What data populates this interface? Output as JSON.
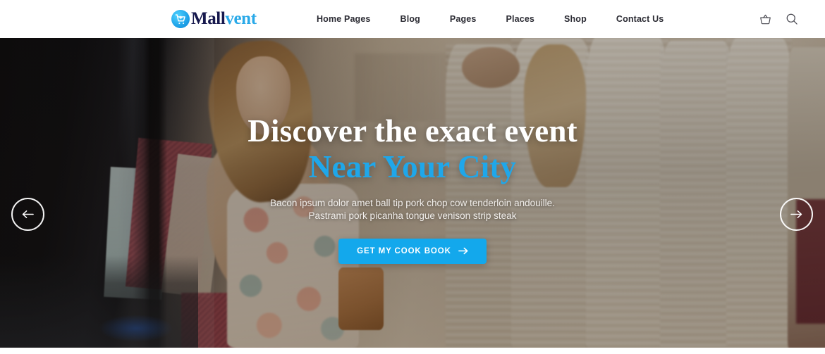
{
  "header": {
    "logo": {
      "icon": "shopping-cart-circle-icon",
      "text_primary": "Mall",
      "text_accent": "vent"
    },
    "nav": [
      {
        "label": "Home Pages",
        "name": "nav-item-home-pages"
      },
      {
        "label": "Blog",
        "name": "nav-item-blog"
      },
      {
        "label": "Pages",
        "name": "nav-item-pages"
      },
      {
        "label": "Places",
        "name": "nav-item-places"
      },
      {
        "label": "Shop",
        "name": "nav-item-shop"
      },
      {
        "label": "Contact Us",
        "name": "nav-item-contact-us"
      }
    ],
    "icons": [
      {
        "name": "shopping-basket-icon"
      },
      {
        "name": "search-icon"
      }
    ]
  },
  "hero": {
    "title_line1": "Discover the exact event",
    "title_line2": "Near Your City",
    "subtitle": "Bacon ipsum dolor amet ball tip pork chop cow tenderloin andouille. Pastrami pork picanha tongue venison strip steak",
    "cta_label": "GET MY COOK BOOK",
    "cta_icon": "arrow-right-icon",
    "prev_icon": "arrow-left-icon",
    "next_icon": "arrow-right-icon",
    "image_alt": "Woman carrying shopping bags in front of a clothing store window with mannequins"
  },
  "colors": {
    "accent": "#13a8ec",
    "title_accent": "#1fa7ea",
    "logo_dark": "#16184d",
    "nav_text": "#2b2b33",
    "header_bg": "#ffffff"
  }
}
